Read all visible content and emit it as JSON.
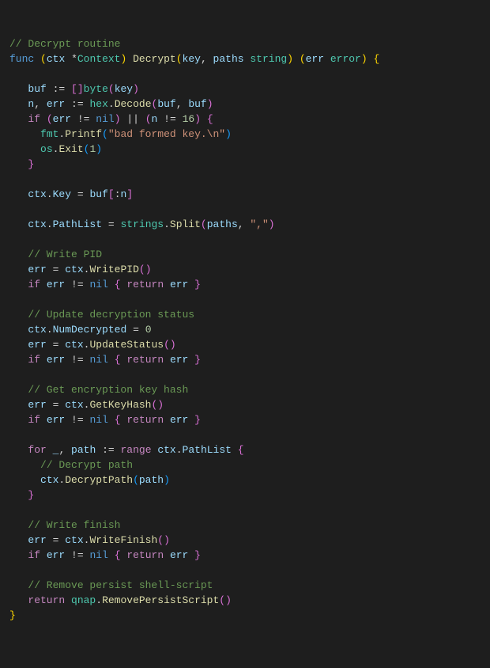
{
  "lines": {
    "c1": "// Decrypt routine",
    "func": "func",
    "ctx": "ctx",
    "star": "*",
    "Context": "Context",
    "Decrypt": "Decrypt",
    "key": "key",
    "paths": "paths",
    "string": "string",
    "err": "err",
    "error": "error",
    "buf": "buf",
    "assign": ":=",
    "byte": "byte",
    "n": "n",
    "hex": "hex",
    "Decode": "Decode",
    "if": "if",
    "ne": "!=",
    "nil": "nil",
    "or": "||",
    "sixteen": "16",
    "fmt": "fmt",
    "Printf": "Printf",
    "badkey": "\"bad formed key.\\n\"",
    "os": "os",
    "Exit": "Exit",
    "one": "1",
    "Key": "Key",
    "eq": "=",
    "colon": ":",
    "PathList": "PathList",
    "strings": "strings",
    "Split": "Split",
    "comma_str": "\",\"",
    "c_writepid": "// Write PID",
    "WritePID": "WritePID",
    "return": "return",
    "c_update": "// Update decryption status",
    "NumDecrypted": "NumDecrypted",
    "zero": "0",
    "UpdateStatus": "UpdateStatus",
    "c_keyhash": "// Get encryption key hash",
    "GetKeyHash": "GetKeyHash",
    "for": "for",
    "underscore": "_",
    "path": "path",
    "range": "range",
    "c_decrypt": "// Decrypt path",
    "DecryptPath": "DecryptPath",
    "c_finish": "// Write finish",
    "WriteFinish": "WriteFinish",
    "c_remove": "// Remove persist shell-script",
    "qnap": "qnap",
    "RemovePersistScript": "RemovePersistScript"
  }
}
